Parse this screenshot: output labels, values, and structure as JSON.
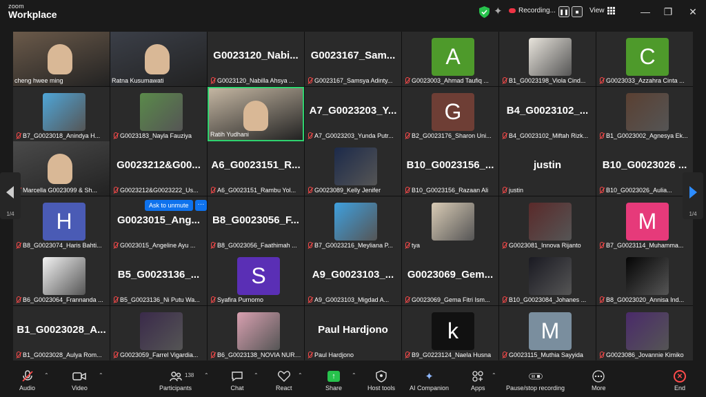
{
  "app": {
    "brand_top": "zoom",
    "brand_main": "Workplace"
  },
  "titlebar": {
    "recording_label": "Recording...",
    "view_label": "View"
  },
  "pager": {
    "left": "1/4",
    "right": "1/4"
  },
  "ask_unmute": "Ask to unmute",
  "more_dots": "···",
  "tiles": [
    {
      "name": "cheng hwee ming",
      "muted": false,
      "kind": "video",
      "bg": "#6b5a4a"
    },
    {
      "name": "Ratna Kusumawati",
      "muted": false,
      "kind": "video",
      "bg": "#3b3f48"
    },
    {
      "name": "G0023120_Nabilla Ahsya ...",
      "muted": true,
      "kind": "text",
      "big": "G0023120_Nabi..."
    },
    {
      "name": "G0023167_Samsya Adinty...",
      "muted": true,
      "kind": "text",
      "big": "G0023167_Sam..."
    },
    {
      "name": "G0023003_Ahmad Taufiq ...",
      "muted": true,
      "kind": "avatar",
      "letter": "A",
      "bg": "#4e9a2b"
    },
    {
      "name": "B1_G0023198_Viola Cind...",
      "muted": true,
      "kind": "image",
      "bg": "#e8e4dc"
    },
    {
      "name": "G0023033_Azzahra Cinta ...",
      "muted": true,
      "kind": "avatar",
      "letter": "C",
      "bg": "#4e9a2b"
    },
    {
      "name": "B7_G0023018_Anindya H...",
      "muted": true,
      "kind": "image",
      "bg": "#4fa6d8"
    },
    {
      "name": "G0023183_Nayla Fauziya",
      "muted": true,
      "kind": "image",
      "bg": "#5a8a4a"
    },
    {
      "name": "Ratih Yudhani",
      "muted": false,
      "kind": "video",
      "bg": "#c4b6a2",
      "active": true
    },
    {
      "name": "A7_G0023203_Yunda Putr...",
      "muted": true,
      "kind": "text",
      "big": "A7_G0023203_Y..."
    },
    {
      "name": "B2_G0023176_Sharon Uni...",
      "muted": true,
      "kind": "avatar",
      "letter": "G",
      "bg": "#6e3e35"
    },
    {
      "name": "B4_G0023102_Miftah Rizk...",
      "muted": true,
      "kind": "text",
      "big": "B4_G0023102_..."
    },
    {
      "name": "B1_G0023002_Agnesya Ek...",
      "muted": true,
      "kind": "image",
      "bg": "#5a4032"
    },
    {
      "name": "Marcella G0023099 & Sh...",
      "muted": true,
      "kind": "video",
      "bg": "#4a4a4a"
    },
    {
      "name": "G0023212&G0023222_Us...",
      "muted": true,
      "kind": "text",
      "big": "G0023212&G00..."
    },
    {
      "name": "A6_G0023151_Rambu Yol...",
      "muted": true,
      "kind": "text",
      "big": "A6_G0023151_R..."
    },
    {
      "name": "G0023089_Kelly Jenifer",
      "muted": true,
      "kind": "image",
      "bg": "#1c2a4a"
    },
    {
      "name": "B10_G0023156_Razaan Ali",
      "muted": true,
      "kind": "text",
      "big": "B10_G0023156_..."
    },
    {
      "name": "justin",
      "muted": true,
      "kind": "text",
      "big": "justin"
    },
    {
      "name": "B10_G0023026_Aulia...",
      "muted": true,
      "kind": "text",
      "big": "B10_G0023026 ..."
    },
    {
      "name": "B8_G0023074_Haris Bahti...",
      "muted": true,
      "kind": "avatar",
      "letter": "H",
      "bg": "#4a5bb5"
    },
    {
      "name": "G0023015_Angeline Ayu ...",
      "muted": true,
      "kind": "text",
      "big": "G0023015_Ang..."
    },
    {
      "name": "B8_G0023056_Faathimah ...",
      "muted": true,
      "kind": "text",
      "big": "B8_G0023056_F..."
    },
    {
      "name": "B7_G0023216_Meyliana P...",
      "muted": true,
      "kind": "image",
      "bg": "#3fa0de"
    },
    {
      "name": "tya",
      "muted": true,
      "kind": "image",
      "bg": "#d9cbb5"
    },
    {
      "name": "G0023081_Innova Rijanto",
      "muted": true,
      "kind": "image",
      "bg": "#5a2a2a"
    },
    {
      "name": "B7_G0023114_Muhamma...",
      "muted": true,
      "kind": "avatar",
      "letter": "M",
      "bg": "#e63a7a"
    },
    {
      "name": "B6_G0023064_Frannanda ...",
      "muted": true,
      "kind": "image",
      "bg": "#f2f2f2"
    },
    {
      "name": "B5_G0023136_Ni Putu Wa...",
      "muted": true,
      "kind": "text",
      "big": "B5_G0023136_..."
    },
    {
      "name": "Syafira Purnomo",
      "muted": true,
      "kind": "avatar",
      "letter": "S",
      "bg": "#5a2fb5"
    },
    {
      "name": "A9_G0023103_Migdad A...",
      "muted": true,
      "kind": "text",
      "big": "A9_G0023103_..."
    },
    {
      "name": "G0023069_Gema Fitri Ism...",
      "muted": true,
      "kind": "text",
      "big": "G0023069_Gem..."
    },
    {
      "name": "B10_G0023084_Johanes ...",
      "muted": true,
      "kind": "image",
      "bg": "#1a1a22"
    },
    {
      "name": "B8_G0023020_Annisa Ind...",
      "muted": true,
      "kind": "image",
      "bg": "#050505"
    },
    {
      "name": "B1_G0023028_Aulya Rom...",
      "muted": true,
      "kind": "text",
      "big": "B1_G0023028_A..."
    },
    {
      "name": "G0023059_Farrel Vigardia...",
      "muted": true,
      "kind": "image",
      "bg": "#3a2a4a"
    },
    {
      "name": "B6_G0023138_NOVIA NURAI...",
      "muted": true,
      "kind": "image",
      "bg": "#d8a0b0"
    },
    {
      "name": "Paul Hardjono",
      "muted": true,
      "kind": "text",
      "big": "Paul Hardjono"
    },
    {
      "name": "B9_G0223124_Naela Husna",
      "muted": true,
      "kind": "avatar",
      "letter": "k",
      "bg": "#111111"
    },
    {
      "name": "G0023115_Muthia Sayyida",
      "muted": true,
      "kind": "avatar",
      "letter": "M",
      "bg": "#7a8e9e"
    },
    {
      "name": "G0023086_Jovannie Kimiko",
      "muted": true,
      "kind": "image",
      "bg": "#4a2a6a"
    }
  ],
  "toolbar": {
    "audio": "Audio",
    "video": "Video",
    "participants": "Participants",
    "participant_count": "138",
    "chat": "Chat",
    "react": "React",
    "share": "Share",
    "host_tools": "Host tools",
    "ai_companion": "AI Companion",
    "apps": "Apps",
    "pause_stop": "Pause/stop recording",
    "more": "More",
    "end": "End"
  },
  "colors": {
    "active_border": "#2fd36f",
    "muted_red": "#ff4b4b",
    "share_green": "#27c24c",
    "accent_blue": "#0e72ed"
  }
}
